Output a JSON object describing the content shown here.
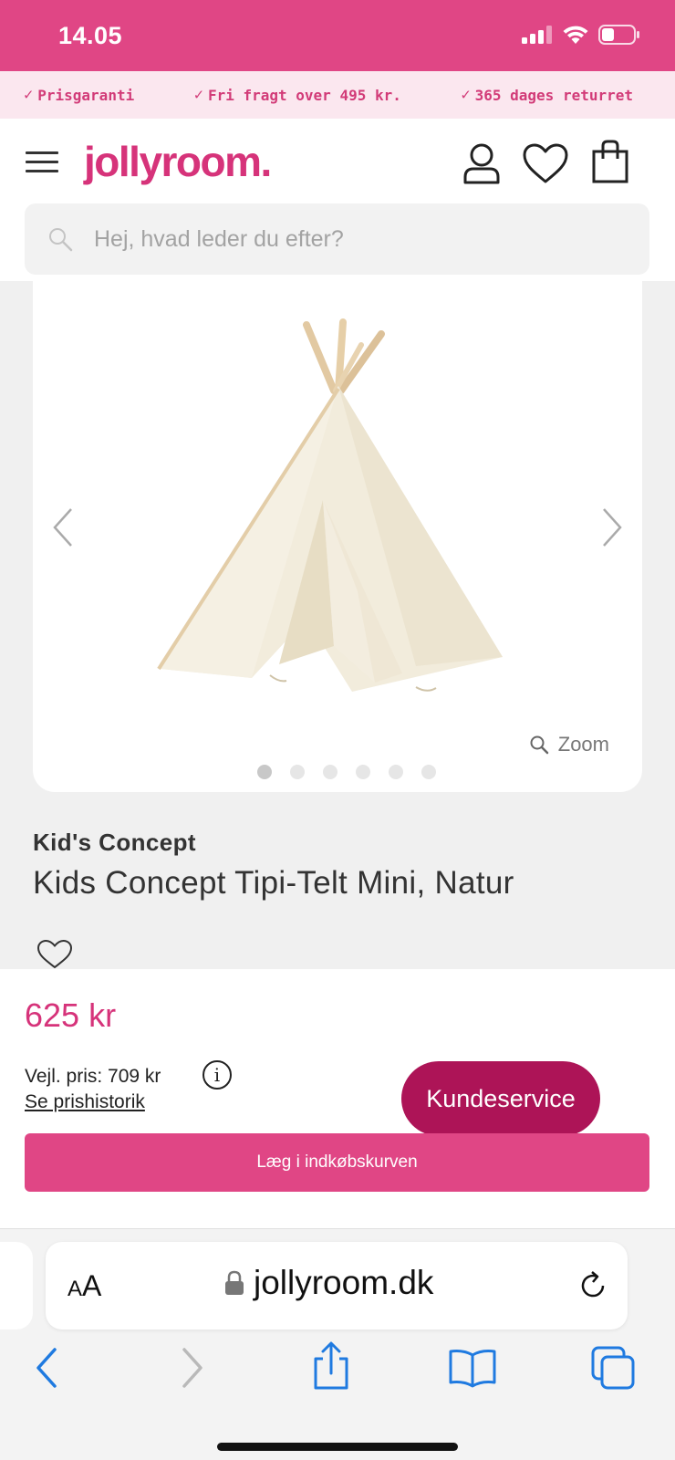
{
  "status_bar": {
    "time": "14.05"
  },
  "usp": [
    {
      "label": "Prisgaranti"
    },
    {
      "label": "Fri fragt over 495 kr."
    },
    {
      "label": "365 dages returret"
    }
  ],
  "header": {
    "logo": "jollyroom.",
    "search_placeholder": "Hej, hvad leder du efter?"
  },
  "gallery": {
    "zoom_label": "Zoom",
    "dot_count": 6,
    "active_dot": 1
  },
  "product": {
    "brand": "Kid's Concept",
    "title": "Kids Concept Tipi-Telt Mini, Natur",
    "price": "625 kr",
    "rrp": "Vejl. pris: 709 kr",
    "history_link": "Se prishistorik",
    "info_symbol": "i"
  },
  "actions": {
    "customer_service": "Kundeservice",
    "add_to_cart": "Læg i indkøbskurven"
  },
  "browser": {
    "aa_small": "A",
    "aa_large": "A",
    "url": "jollyroom.dk"
  },
  "colors": {
    "brand_pink": "#e04685",
    "logo_pink": "#d6337a",
    "customer_service_bg": "#ad1457",
    "usp_bg": "#fbe7ef"
  }
}
